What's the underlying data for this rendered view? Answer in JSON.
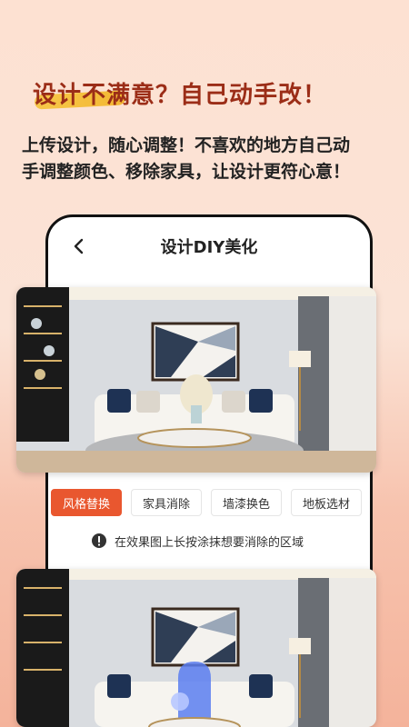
{
  "headline": {
    "highlight": "设计",
    "text": "设计不满意？自己动手改！"
  },
  "subtitle": {
    "line1": "上传设计，随心调整！不喜欢的地方自己动",
    "line2": "手调整颜色、移除家具，让设计更符心意！"
  },
  "phone": {
    "nav": {
      "back_icon": "chevron-left-icon",
      "title": "设计DIY美化"
    },
    "chips": [
      {
        "label": "风格替换",
        "active": true
      },
      {
        "label": "家具消除",
        "active": false
      },
      {
        "label": "墙漆换色",
        "active": false
      },
      {
        "label": "地板选材",
        "active": false
      }
    ],
    "hint": {
      "icon": "info-icon",
      "text": "在效果图上长按涂抹想要消除的区域"
    }
  },
  "colors": {
    "accent": "#e9572f",
    "headline": "#9b2d17",
    "brush": "#f6c642"
  }
}
